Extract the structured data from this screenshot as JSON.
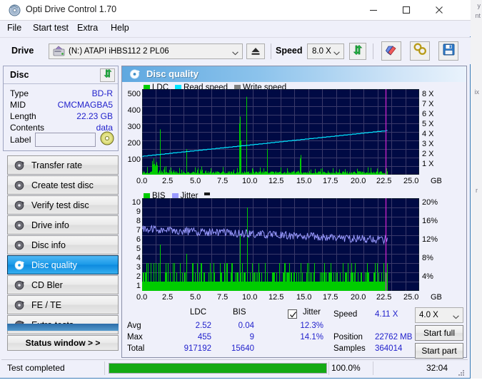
{
  "window": {
    "title": "Opti Drive Control 1.70",
    "icon": "disc-app-icon",
    "minimize": "minimize-icon",
    "maximize": "maximize-icon",
    "close": "close-icon"
  },
  "menu": [
    {
      "label": "File",
      "name": "menu-file"
    },
    {
      "label": "Start test",
      "name": "menu-start-test"
    },
    {
      "label": "Extra",
      "name": "menu-extra"
    },
    {
      "label": "Help",
      "name": "menu-help"
    }
  ],
  "toolbar": {
    "drive_label": "Drive",
    "drive_value": "(N:)  ATAPI iHBS112  2 PL06",
    "eject_icon": "eject-icon",
    "speed_label": "Speed",
    "speed_value": "8.0 X",
    "refresh_icon": "refresh-icon",
    "erase_icon": "eraser-icon",
    "settings_icon": "settings-icon",
    "save_icon": "save-icon"
  },
  "disc_panel": {
    "title": "Disc",
    "refresh_icon": "refresh-green-arrows-icon",
    "rows": [
      {
        "label": "Type",
        "value": "BD-R"
      },
      {
        "label": "MID",
        "value": "CMCMAGBA5"
      },
      {
        "label": "Length",
        "value": "22.23 GB"
      },
      {
        "label": "Contents",
        "value": "data"
      }
    ],
    "label_field_label": "Label",
    "label_field_value": "",
    "label_field_placeholder": "",
    "disc_icon": "cd-disc-icon"
  },
  "nav": {
    "items": [
      {
        "label": "Transfer rate",
        "name": "sidebar-item-transfer-rate",
        "icon": "disc-speed-icon",
        "active": false
      },
      {
        "label": "Create test disc",
        "name": "sidebar-item-create-test-disc",
        "icon": "disc-burn-icon",
        "active": false
      },
      {
        "label": "Verify test disc",
        "name": "sidebar-item-verify-test-disc",
        "icon": "disc-check-icon",
        "active": false
      },
      {
        "label": "Drive info",
        "name": "sidebar-item-drive-info",
        "icon": "drive-info-icon",
        "active": false
      },
      {
        "label": "Disc info",
        "name": "sidebar-item-disc-info",
        "icon": "disc-info-icon",
        "active": false
      },
      {
        "label": "Disc quality",
        "name": "sidebar-item-disc-quality",
        "icon": "disc-quality-icon",
        "active": true
      },
      {
        "label": "CD Bler",
        "name": "sidebar-item-cd-bler",
        "icon": "disc-bler-icon",
        "active": false
      },
      {
        "label": "FE / TE",
        "name": "sidebar-item-fe-te",
        "icon": "disc-fete-icon",
        "active": false
      },
      {
        "label": "Extra tests",
        "name": "sidebar-item-extra-tests",
        "icon": "disc-extra-icon",
        "active": false
      }
    ],
    "status_window_label": "Status window > >"
  },
  "content": {
    "title": "Disc quality",
    "icon": "disc-quality-icon"
  },
  "stats": {
    "col_ldc": "LDC",
    "col_bis": "BIS",
    "jitter_label": "Jitter",
    "jitter_checked": true,
    "rows": [
      {
        "label": "Avg",
        "ldc": "2.52",
        "bis": "0.04",
        "jitter": "12.3%"
      },
      {
        "label": "Max",
        "ldc": "455",
        "bis": "9",
        "jitter": "14.1%"
      },
      {
        "label": "Total",
        "ldc": "917192",
        "bis": "15640",
        "jitter": ""
      }
    ],
    "speed_label": "Speed",
    "speed_value": "4.11 X",
    "position_label": "Position",
    "position_value": "22762 MB",
    "samples_label": "Samples",
    "samples_value": "364014",
    "speed_select": "4.0 X",
    "start_full": "Start full",
    "start_part": "Start part"
  },
  "status_bar": {
    "text": "Test completed",
    "progress_pct": "100.0%",
    "progress_value": 100,
    "elapsed": "32:04",
    "grip_icon": "resize-grip-icon"
  },
  "colors": {
    "ldc_green": "#00cc00",
    "read_speed_cyan": "#00e5ff",
    "write_speed_gray": "#808080",
    "bis_green": "#00cc00",
    "jitter_lavender": "#9a9aff",
    "plot_bg": "#000a44",
    "grid": "#3a3a6a",
    "accent_blue": "#1b9ae8",
    "value_blue": "#2222cc",
    "progress_green": "#14a914",
    "marker_magenta": "#cc22cc"
  },
  "chart_data": [
    {
      "type": "line",
      "name": "ldc-read-speed-chart",
      "title": "LDC / Read speed",
      "xlabel": "GB",
      "ylabel": "LDC",
      "y2label": "X",
      "xlim": [
        0,
        25.0
      ],
      "ylim": [
        0,
        500
      ],
      "y2lim": [
        0,
        8
      ],
      "grid": true,
      "legend_position": "top-left",
      "xticks": [
        "0.0",
        "2.5",
        "5.0",
        "7.5",
        "10.0",
        "12.5",
        "15.0",
        "17.5",
        "20.0",
        "22.5",
        "25.0"
      ],
      "xunit": "GB",
      "yticks": [
        100,
        200,
        300,
        400,
        500
      ],
      "y2ticks": [
        "1 X",
        "2 X",
        "3 X",
        "4 X",
        "5 X",
        "6 X",
        "7 X",
        "8 X"
      ],
      "series": [
        {
          "name": "LDC",
          "color": "#00cc00",
          "style": "bars",
          "note": "dense noise floor ~5-20 with spikes; peaks at x=1.6 (265), x=8.8 (340), x=9.4 (455), x=4.0 (150), x=11.3 (150), x=14.3 (115), x=22.0 (235)"
        },
        {
          "name": "Read speed",
          "color": "#00e5ff",
          "style": "line",
          "note": "rises steadily (CAV) from about 1.7 X at 0 GB to about 4.1 X at 22.2 GB, stepwise"
        },
        {
          "name": "Write speed",
          "color": "#808080",
          "style": "line",
          "note": "not plotted"
        }
      ],
      "legend": [
        "LDC",
        "Read speed",
        "Write speed"
      ],
      "annotations": [
        {
          "type": "vline",
          "x": 22.0,
          "color": "#cc22cc",
          "label": "end-of-data marker"
        }
      ]
    },
    {
      "type": "line",
      "name": "bis-jitter-chart",
      "title": "BIS / Jitter",
      "xlabel": "GB",
      "ylabel": "BIS",
      "y2label": "%",
      "xlim": [
        0,
        25.0
      ],
      "ylim": [
        0,
        10
      ],
      "y2lim": [
        0,
        20
      ],
      "grid": true,
      "legend_position": "top-left",
      "xticks": [
        "0.0",
        "2.5",
        "5.0",
        "7.5",
        "10.0",
        "12.5",
        "15.0",
        "17.5",
        "20.0",
        "22.5",
        "25.0"
      ],
      "xunit": "GB",
      "yticks": [
        1,
        2,
        3,
        4,
        5,
        6,
        7,
        8,
        9,
        10
      ],
      "y2ticks": [
        "4%",
        "8%",
        "12%",
        "16%",
        "20%"
      ],
      "series": [
        {
          "name": "BIS",
          "color": "#00cc00",
          "style": "bars",
          "note": "solid fill to ~1-2 across 0-22.1 GB, frequent spikes to 2-3, notable spikes: x=1.6 (5), x=4.0 (4), x=8.8 (6), x=9.5 (9), x=22.0 (5)"
        },
        {
          "name": "Jitter",
          "color": "#9a9aff",
          "style": "line",
          "note": "noisy band averaging about 12.3%, starting near 13.5% at 0 GB drifting to about 11% near 22 GB; max 14.1%"
        }
      ],
      "legend": [
        "BIS",
        "Jitter"
      ],
      "annotations": [
        {
          "type": "vline",
          "x": 22.0,
          "color": "#cc22cc",
          "label": "end-of-data marker"
        }
      ]
    }
  ],
  "bg_window": {
    "frag_top": "y",
    "frag_2": "nt",
    "frag_3": "ix",
    "frag_4": "r"
  }
}
